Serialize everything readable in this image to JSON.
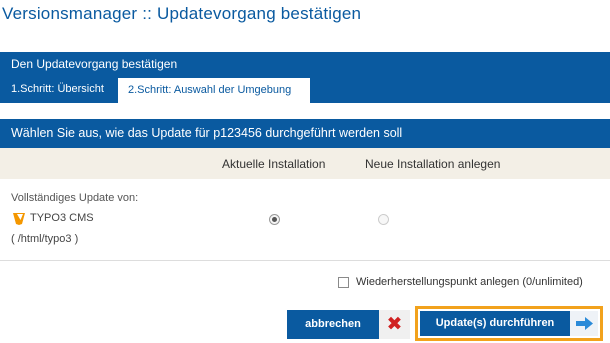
{
  "page": {
    "title": "Versionsmanager :: Updatevorgang bestätigen"
  },
  "confirm": {
    "heading": "Den Updatevorgang bestätigen",
    "tabs": [
      {
        "label": "1.Schritt: Übersicht",
        "active": true
      },
      {
        "label": "2.Schritt: Auswahl der Umgebung",
        "active": false
      }
    ]
  },
  "selection": {
    "heading": "Wählen Sie aus, wie das Update für p123456 durchgeführt werden soll",
    "columns": [
      "Aktuelle Installation",
      "Neue Installation anlegen"
    ],
    "row": {
      "label": "Vollständiges Update von:",
      "product": "TYPO3 CMS",
      "product_icon": "typo3-logo-icon",
      "path": "( /html/typo3 )",
      "current_selected": true,
      "new_enabled": false
    }
  },
  "restore_point": {
    "label": "Wiederherstellungspunkt anlegen (0/unlimited)",
    "checked": false
  },
  "buttons": {
    "cancel": "abbrechen",
    "update": "Update(s) durchführen"
  },
  "colors": {
    "primary": "#0a5aa0",
    "highlight": "#f2a21c",
    "cancel_x": "#d02020",
    "table_header_bg": "#f3efe6"
  }
}
